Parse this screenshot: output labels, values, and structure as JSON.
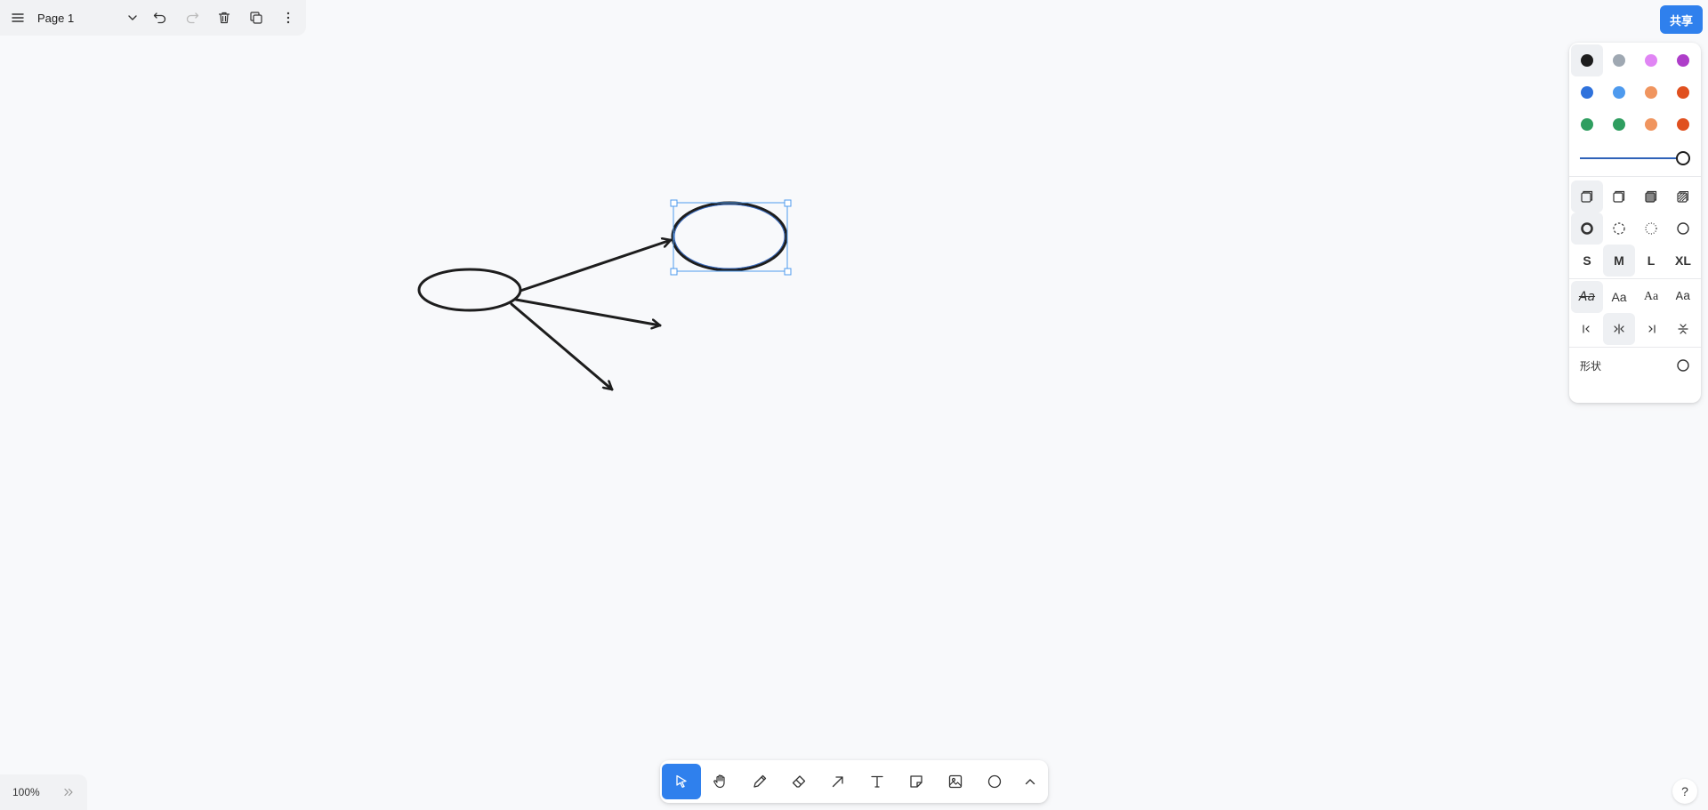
{
  "topbar": {
    "page_name": "Page 1"
  },
  "share": {
    "label": "共享"
  },
  "style_panel": {
    "colors": [
      "#1d1d1d",
      "#9fa8b2",
      "#e085f4",
      "#ae3ec9",
      "#2f72dc",
      "#4e9aee",
      "#f0955f",
      "#e0501f",
      "#2f9e60",
      "#2f9e60",
      "#f0955f",
      "#e0501f"
    ],
    "selected_color": "#1d1d1d",
    "opacity": 1,
    "sizes": [
      "S",
      "M",
      "L",
      "XL"
    ],
    "selected_size": "M",
    "fonts": [
      "Aa",
      "Aa",
      "Aa",
      "Aa"
    ],
    "shape_label": "形状"
  },
  "zoom": {
    "value": "100%"
  },
  "help": {
    "label": "?"
  },
  "canvas": {
    "selected_shape": "ellipse"
  }
}
